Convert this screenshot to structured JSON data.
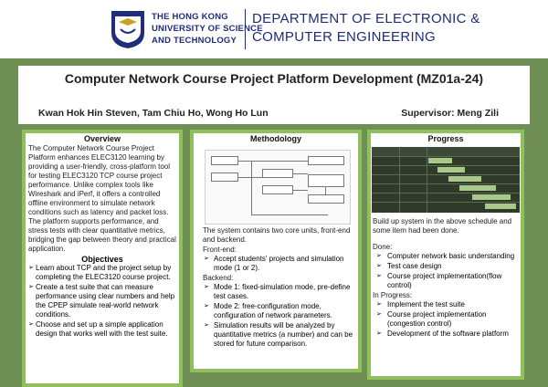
{
  "header": {
    "university_lines": [
      "THE HONG KONG",
      "UNIVERSITY OF SCIENCE",
      "AND TECHNOLOGY"
    ],
    "department_lines": [
      "DEPARTMENT OF ELECTRONIC &",
      "COMPUTER ENGINEERING"
    ],
    "brand_color": "#1f2d7a",
    "logo_icon": "hkust-logo"
  },
  "title": "Computer Network Course Project Platform Development (MZ01a-24)",
  "authors": "Kwan Hok Hin Steven, Tam Chiu Ho, Wong Ho Lun",
  "supervisor": "Supervisor: Meng Zili",
  "overview": {
    "heading": "Overview",
    "text": "The Computer Network Course Project Platform enhances ELEC3120 learning by providing a user-friendly, cross-platform tool for testing ELEC3120 TCP course project performance. Unlike complex tools like Wireshark and iPerf, it offers a controlled offline environment to simulate network conditions such as latency and packet loss. The platform supports performance, and stress tests with clear quantitative metrics, bridging the gap between theory and practical application.",
    "objectives_heading": "Objectives",
    "objectives": [
      "Learn about TCP and the project setup by completing the ELEC3120 course project.",
      "Create a test suite that can measure performance using clear numbers and help the CPEP simulate real-world network conditions.",
      "Choose and set up a simple application design that works well with the test suite."
    ]
  },
  "methodology": {
    "heading": "Methodology",
    "intro": "The system contains two core units, front-end and backend.",
    "frontend_label": "Front-end:",
    "frontend_items": [
      "Accept students' projects and simulation mode (1 or 2)."
    ],
    "backend_label": "Backend:",
    "backend_items": [
      "Mode 1: fixed-simulation mode, pre-define test cases.",
      "Mode 2: free-configuration mode, configuration of network parameters.",
      "Simulation results will be analyzed by quantitative metrics (a number) and can be stored for future comparison."
    ]
  },
  "progress": {
    "heading": "Progress",
    "intro": "Build up system in the above schedule and some item had been done.",
    "done_label": "Done:",
    "done_items": [
      "Computer network basic understanding",
      "Test case design",
      "Course project implementation(flow control)"
    ],
    "in_progress_label": "In Progress:",
    "in_progress_items": [
      "Implement the test suite",
      "Course project implementation (congestion control)",
      "Development of the software platform"
    ]
  },
  "colors": {
    "background": "#6f8f55",
    "panel_border": "#8ec05b",
    "gantt_bar": "#a8c98a"
  }
}
